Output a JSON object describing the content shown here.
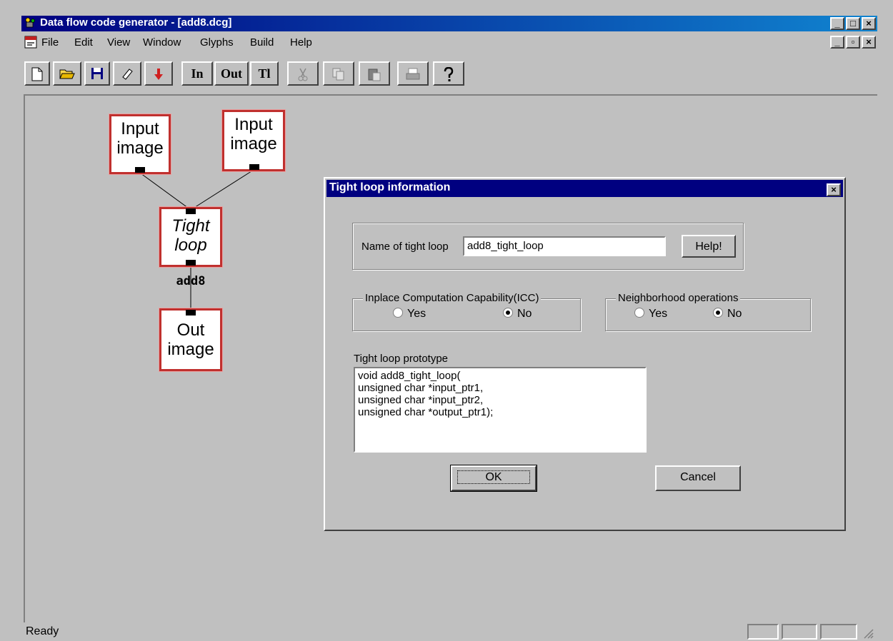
{
  "window": {
    "title": "Data flow code generator - [add8.dcg]",
    "caption_minimize": "_",
    "caption_maximize": "□",
    "caption_close": "×",
    "mdi_minimize": "_",
    "mdi_restore": "▫",
    "mdi_close": "×"
  },
  "menu": {
    "items": [
      {
        "label": "File"
      },
      {
        "label": "Edit"
      },
      {
        "label": "View"
      },
      {
        "label": "Window"
      },
      {
        "label": "Glyphs"
      },
      {
        "label": "Build"
      },
      {
        "label": "Help"
      }
    ]
  },
  "toolbar": {
    "in_label": "In",
    "out_label": "Out",
    "tl_label": "Tl",
    "icons": [
      "new-icon",
      "open-icon",
      "save-icon",
      "eraser-icon",
      "arrow-down-icon",
      "cut-icon",
      "copy-icon",
      "paste-icon",
      "print-icon",
      "help-icon"
    ]
  },
  "canvas": {
    "glyph1": {
      "line1": "Input",
      "line2": "image"
    },
    "glyph2": {
      "line1": "Input",
      "line2": "image"
    },
    "glyph3": {
      "line1": "Tight",
      "line2": "loop",
      "caption": "add8"
    },
    "glyph4": {
      "line1": "Out",
      "line2": "image"
    }
  },
  "dialog": {
    "title": "Tight loop information",
    "close": "×",
    "name_label": "Name of tight loop",
    "name_value": "add8_tight_loop",
    "help_button": "Help!",
    "icc_group": "Inplace Computation Capability(ICC)",
    "icc_yes": "Yes",
    "icc_no": "No",
    "icc_selected": "No",
    "neigh_group": "Neighborhood operations",
    "neigh_yes": "Yes",
    "neigh_no": "No",
    "neigh_selected": "No",
    "prototype_label": "Tight loop prototype",
    "prototype_text": "void add8_tight_loop(\nunsigned char *input_ptr1,\nunsigned char *input_ptr2,\nunsigned char *output_ptr1);",
    "ok_button": "OK",
    "cancel_button": "Cancel"
  },
  "status": {
    "text": "Ready"
  }
}
